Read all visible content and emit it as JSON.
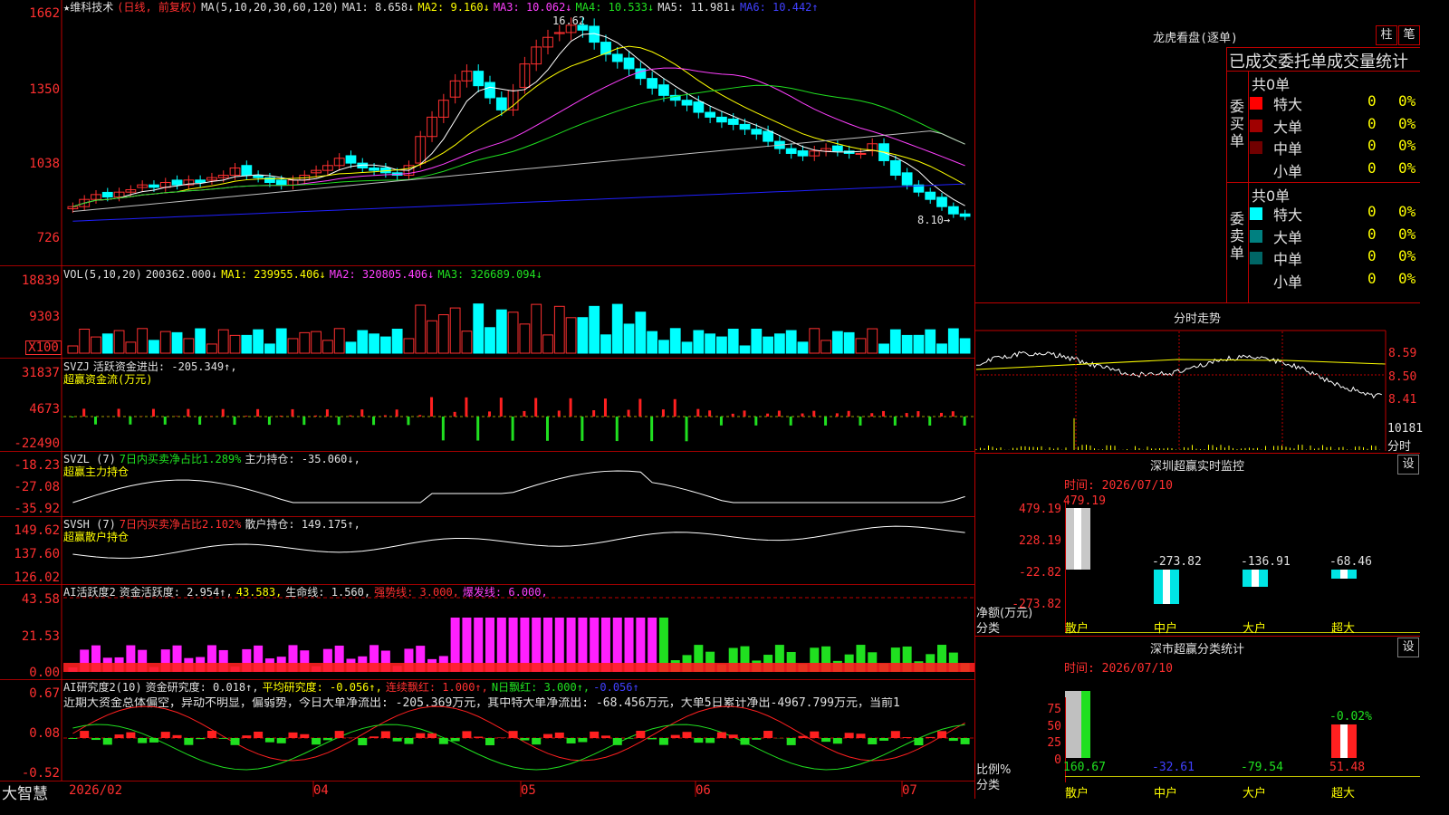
{
  "stock": {
    "name": "★维科技术",
    "period": "(日线, 前复权)",
    "ma_label": "MA(5,10,20,30,60,120)",
    "ma1": "MA1: 8.658↓",
    "ma2": "MA2: 9.160↓",
    "ma3": "MA3: 10.062↓",
    "ma4": "MA4: 10.533↓",
    "ma5": "MA5: 11.981↓",
    "ma6": "MA6: 10.442↑",
    "high_mark": "16.62",
    "low_mark": "8.10→",
    "price_axis": [
      "1662",
      "1350",
      "1038",
      "726"
    ]
  },
  "vol": {
    "label": "VOL(5,10,20)",
    "value": "200362.000↓",
    "ma1": "MA1: 239955.406↓",
    "ma2": "MA2: 320805.406↓",
    "ma3": "MA3: 326689.094↓",
    "axis": [
      "18839",
      "9303",
      "X100"
    ]
  },
  "svzj": {
    "label": "SVZJ",
    "text": "活跃资金进出: -205.349↑,",
    "sub": "超赢资金流(万元)",
    "axis": [
      "31837",
      "4673",
      "-22490"
    ]
  },
  "svzl": {
    "label": "SVZL (7)",
    "ratio": "7日内买卖净占比1.289%",
    "hold": "主力持仓: -35.060↓,",
    "sub": "超赢主力持仓",
    "axis": [
      "-18.23",
      "-27.08",
      "-35.92"
    ]
  },
  "svsh": {
    "label": "SVSH (7)",
    "ratio": "7日内买卖净占比2.102%",
    "hold": "散户持仓: 149.175↑,",
    "sub": "超赢散户持仓",
    "axis": [
      "149.62",
      "137.60",
      "126.02"
    ]
  },
  "ai1": {
    "label": "AI活跃度2",
    "a": "资金活跃度: 2.954↑,",
    "b": "43.583,",
    "c": "生命线: 1.560,",
    "d": "强势线: 3.000,",
    "e": "爆发线: 6.000,",
    "axis": [
      "43.58",
      "21.53",
      "0.00"
    ]
  },
  "ai2": {
    "label": "AI研究度2(10)",
    "a": "资金研究度: 0.018↑,",
    "b": "平均研究度: -0.056↑,",
    "c": "连续飘红: 1.000↑,",
    "d": "N日飘红: 3.000↑,",
    "e": "-0.056↑",
    "comment": "近期大资金总体偏空，异动不明显，偏弱势，今日大单净流出: -205.369万元，其中特大单净流出: -68.456万元，大单5日累计净出-4967.799万元，当前1",
    "axis": [
      "0.67",
      "0.08",
      "-0.52"
    ]
  },
  "dates": [
    "2026/02",
    "04",
    "05",
    "06",
    "07"
  ],
  "brand": "大智慧",
  "right": {
    "lhb_title": "龙虎看盘(逐单)",
    "btn_zhu": "柱",
    "btn_bi": "笔",
    "header": "已成交委托单成交量统计",
    "buy_label": "委买单",
    "sell_label": "委卖单",
    "buy_total": "共0单",
    "sell_total": "共0单",
    "buy_rows": [
      {
        "name": "特大",
        "n": "0",
        "pct": "0%",
        "color": "#ff0000"
      },
      {
        "name": "大单",
        "n": "0",
        "pct": "0%",
        "color": "#a00000"
      },
      {
        "name": "中单",
        "n": "0",
        "pct": "0%",
        "color": "#700000"
      },
      {
        "name": "小单",
        "n": "0",
        "pct": "0%",
        "color": "#000000"
      }
    ],
    "sell_rows": [
      {
        "name": "特大",
        "n": "0",
        "pct": "0%",
        "color": "#00ffff"
      },
      {
        "name": "大单",
        "n": "0",
        "pct": "0%",
        "color": "#008080"
      },
      {
        "name": "中单",
        "n": "0",
        "pct": "0%",
        "color": "#006666"
      },
      {
        "name": "小单",
        "n": "0",
        "pct": "0%",
        "color": "#000000"
      }
    ],
    "fs_title": "分时走势",
    "fs_axis": [
      "8.59",
      "8.50",
      "8.41"
    ],
    "fs_vol": "10181",
    "fs_vol_unit": "分时",
    "sz_title": "深圳超赢实时监控",
    "sz_btn": "设",
    "sz_time": "时间: 2026/07/10",
    "sz_axis": [
      "479.19",
      "228.19",
      "-22.82",
      "-273.82"
    ],
    "sz_axis_label1": "净额(万元)",
    "sz_axis_label2": "分类",
    "sz_cats": [
      "散户",
      "中户",
      "大户",
      "超大"
    ],
    "sz_vals": [
      "479.19",
      "-273.82",
      "-136.91",
      "-68.46"
    ],
    "cls_title": "深市超赢分类统计",
    "cls_btn": "设",
    "cls_time": "时间: 2026/07/10",
    "cls_axis": [
      "75",
      "50",
      "25",
      "0"
    ],
    "cls_axis_label1": "比例%",
    "cls_axis_label2": "分类",
    "cls_cats": [
      "散户",
      "中户",
      "大户",
      "超大"
    ],
    "cls_vals": [
      "160.67",
      "-32.61",
      "-79.54",
      "51.48"
    ],
    "cls_top": "-0.02%"
  },
  "chart_data": {
    "type": "candlestick",
    "period": "daily",
    "price_high": 16.62,
    "price_low": 8.1,
    "closes": [
      8.6,
      8.9,
      9.1,
      9.0,
      9.2,
      9.3,
      9.5,
      9.4,
      9.6,
      9.5,
      9.7,
      9.6,
      9.8,
      9.9,
      10.2,
      9.9,
      9.8,
      9.6,
      9.5,
      9.7,
      9.9,
      10.1,
      10.3,
      10.6,
      10.4,
      10.2,
      10.1,
      10.0,
      9.9,
      10.3,
      11.5,
      12.3,
      13.0,
      13.8,
      14.2,
      13.6,
      13.1,
      12.6,
      13.4,
      14.5,
      15.2,
      15.6,
      15.8,
      16.1,
      15.9,
      15.4,
      14.9,
      14.6,
      14.3,
      13.9,
      13.5,
      13.2,
      13.0,
      12.8,
      12.5,
      12.3,
      12.1,
      12.0,
      11.8,
      11.6,
      11.3,
      11.0,
      10.8,
      10.7,
      10.9,
      11.0,
      10.9,
      10.8,
      10.8,
      11.2,
      10.5,
      9.9,
      9.5,
      9.2,
      8.9,
      8.6,
      8.3,
      8.2
    ],
    "vol_max": 18839
  }
}
